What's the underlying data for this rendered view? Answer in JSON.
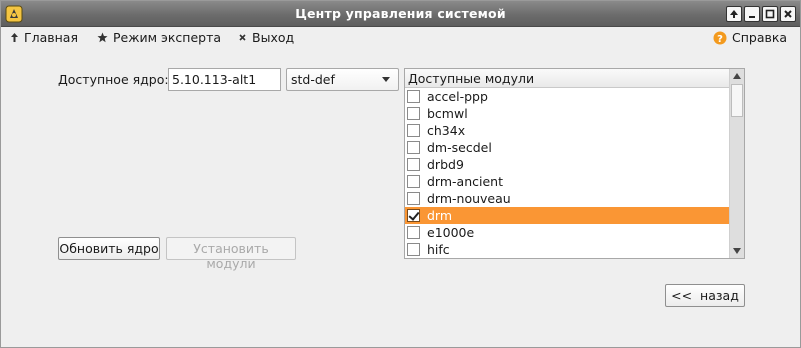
{
  "window": {
    "title": "Центр управления системой"
  },
  "toolbar": {
    "home_label": "Главная",
    "expert_label": "Режим эксперта",
    "exit_label": "Выход",
    "help_label": "Справка"
  },
  "kernel": {
    "label": "Доступное ядро:",
    "version": "5.10.113-alt1",
    "flavour": "std-def"
  },
  "modules": {
    "header": "Доступные модули",
    "items": [
      {
        "name": "accel-ppp",
        "checked": false,
        "selected": false
      },
      {
        "name": "bcmwl",
        "checked": false,
        "selected": false
      },
      {
        "name": "ch34x",
        "checked": false,
        "selected": false
      },
      {
        "name": "dm-secdel",
        "checked": false,
        "selected": false
      },
      {
        "name": "drbd9",
        "checked": false,
        "selected": false
      },
      {
        "name": "drm-ancient",
        "checked": false,
        "selected": false
      },
      {
        "name": "drm-nouveau",
        "checked": false,
        "selected": false
      },
      {
        "name": "drm",
        "checked": true,
        "selected": true
      },
      {
        "name": "e1000e",
        "checked": false,
        "selected": false
      },
      {
        "name": "hifc",
        "checked": false,
        "selected": false
      }
    ]
  },
  "buttons": {
    "update_kernel": "Обновить ядро",
    "install_modules": "Установить модули",
    "back": "<<  назад"
  },
  "colors": {
    "selection": "#fa9634",
    "titlebar": "#6c6c6c",
    "help_icon": "#f39a1e"
  },
  "icons": {
    "home": "arrow-up-icon",
    "expert": "star-icon",
    "exit": "close-icon",
    "help": "question-circle-icon"
  }
}
